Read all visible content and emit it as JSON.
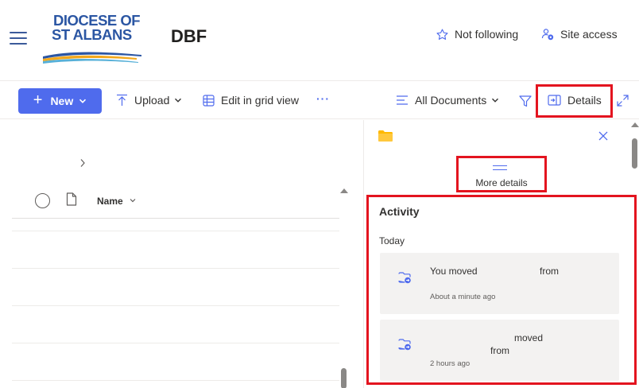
{
  "header": {
    "logo_line1": "DIOCESE OF",
    "logo_line2": "ST ALBANS",
    "site_title": "DBF",
    "follow_label": "Not following",
    "site_access_label": "Site access"
  },
  "commandbar": {
    "new_label": "New",
    "upload_label": "Upload",
    "grid_label": "Edit in grid view",
    "more_label": "···",
    "view_label": "All Documents",
    "details_label": "Details"
  },
  "list": {
    "column_name": "Name"
  },
  "details_pane": {
    "more_details_label": "More details",
    "activity_title": "Activity",
    "group_label": "Today",
    "activities": [
      {
        "text_a": "You moved",
        "text_b": "from",
        "time": "About a minute ago"
      },
      {
        "text_a": "moved",
        "text_b": "from",
        "time": "2 hours ago"
      }
    ]
  },
  "colors": {
    "accent": "#4f6bed",
    "highlight_border": "#e3141f",
    "logo_blue": "#2b56a3",
    "logo_gold": "#f3a81b"
  }
}
